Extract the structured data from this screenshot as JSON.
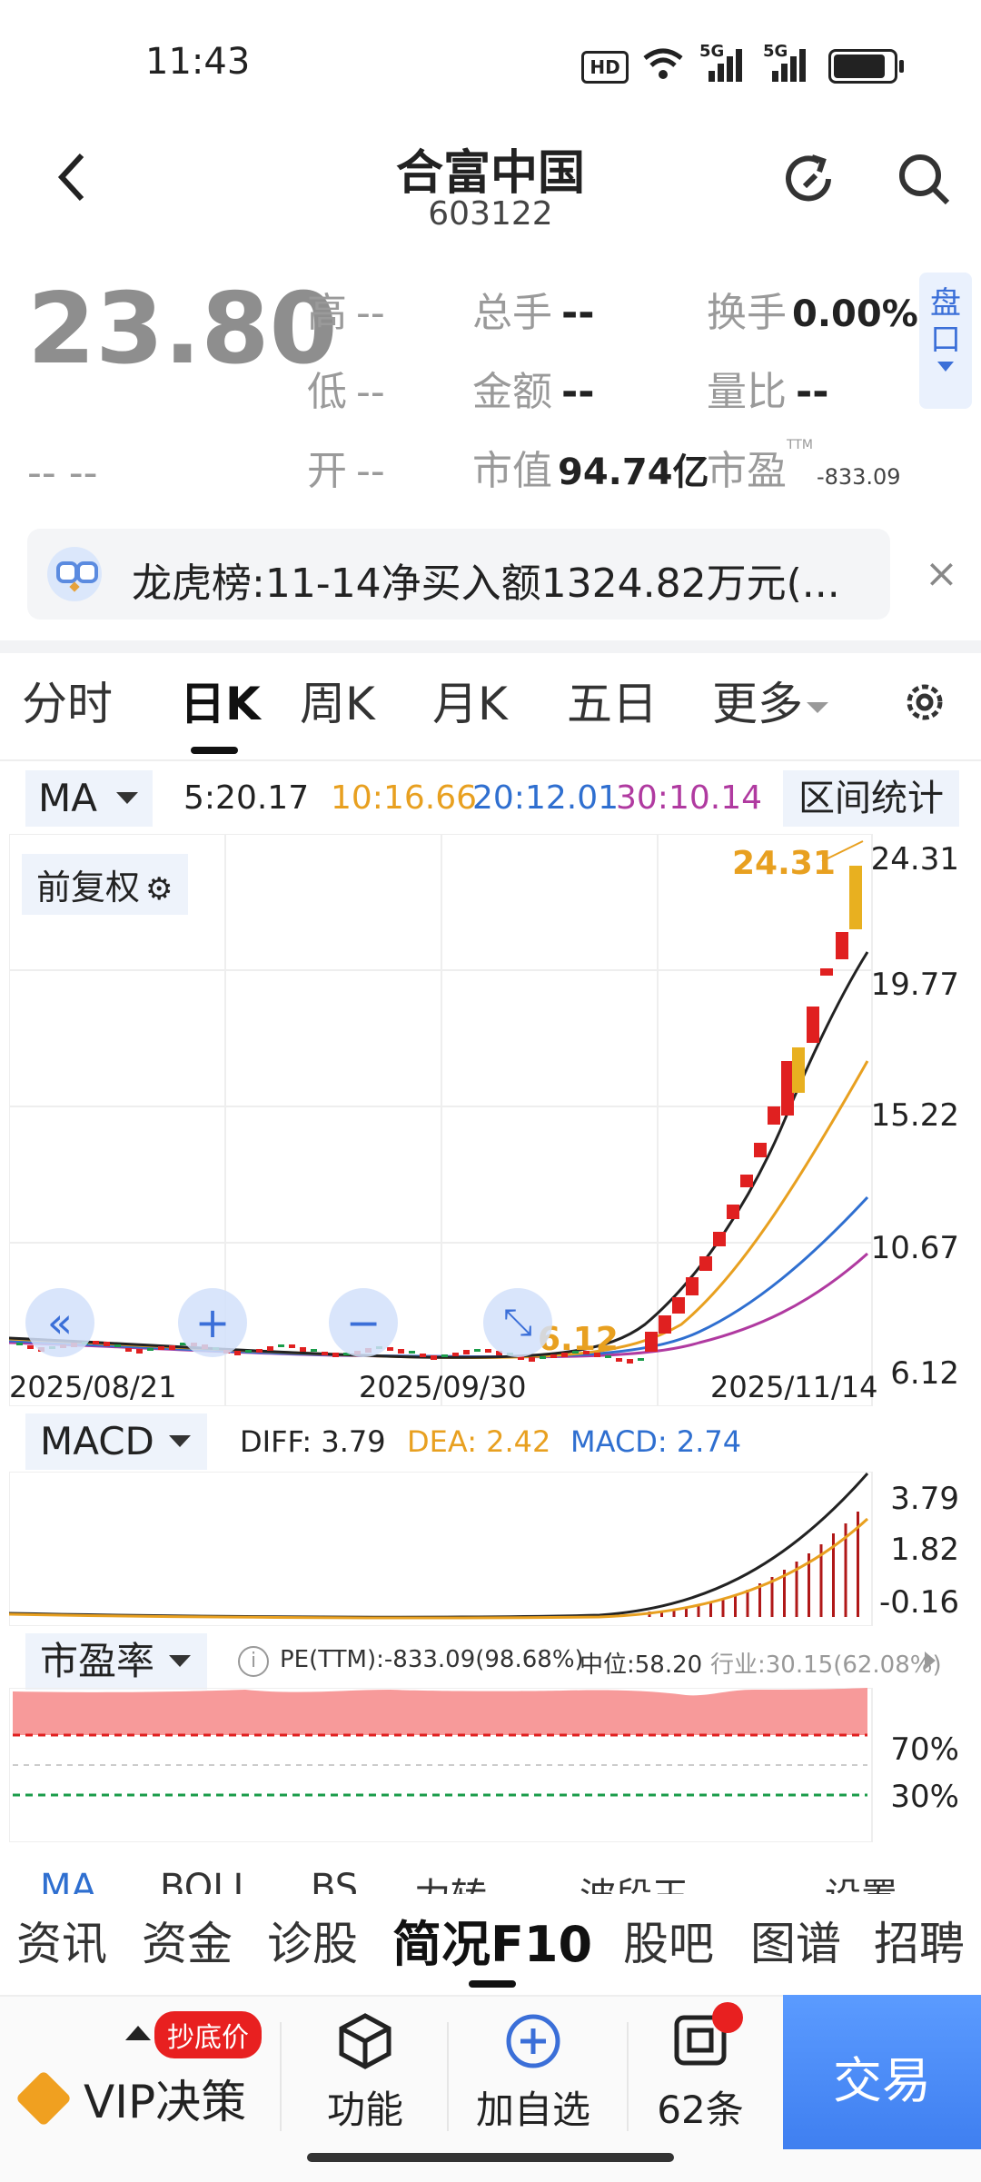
{
  "status_bar": {
    "time": "11:43",
    "hd": "HD",
    "net1": "5G",
    "net2": "5G"
  },
  "header": {
    "title": "合富中国",
    "code": "603122"
  },
  "quote": {
    "price": "23.80",
    "change": "-- --",
    "high_label": "高",
    "high_value": "--",
    "low_label": "低",
    "low_value": "--",
    "open_label": "开",
    "open_value": "--",
    "volume_label": "总手",
    "volume_value": "--",
    "amount_label": "金额",
    "amount_value": "--",
    "mktcap_label": "市值",
    "mktcap_value": "94.74亿",
    "turnover_label": "换手",
    "turnover_value": "0.00%",
    "volratio_label": "量比",
    "volratio_value": "--",
    "pe_label": "市盈",
    "pe_sup": "TTM",
    "pe_value": "-833.09",
    "pankou": "盘口"
  },
  "banner": {
    "text": "龙虎榜:11-14净买入额1324.82万元(..."
  },
  "tabs": [
    "分时",
    "日K",
    "周K",
    "月K",
    "五日",
    "更多"
  ],
  "active_tab": "日K",
  "ma_bar": {
    "selector": "MA",
    "ma5": "5:20.17",
    "ma10": "10:16.66",
    "ma20": "20:12.01",
    "ma30": "30:10.14",
    "range_stats": "区间统计"
  },
  "kline": {
    "adjust_label": "前复权",
    "max_label": "24.31",
    "min_label": "6.12",
    "y_ticks": [
      "24.31",
      "19.77",
      "15.22",
      "10.67",
      "6.12"
    ],
    "x_ticks": [
      "2025/08/21",
      "2025/09/30",
      "2025/11/14"
    ]
  },
  "macd": {
    "selector": "MACD",
    "diff": "DIFF: 3.79",
    "dea": "DEA: 2.42",
    "macd": "MACD: 2.74",
    "y_ticks": [
      "3.79",
      "1.82",
      "-0.16"
    ]
  },
  "pe_panel": {
    "selector": "市盈率",
    "pe_ttm": "PE(TTM):-833.09(98.68%)",
    "median": "中位:58.20",
    "industry": "行业:30.15(62.08%)",
    "y_ticks": [
      "70%",
      "30%"
    ]
  },
  "indicator_row": [
    "MA",
    "BOLL",
    "BS",
    "力转",
    "波段王",
    "设置"
  ],
  "f10_tabs": [
    "资讯",
    "资金",
    "诊股",
    "简况F10",
    "股吧",
    "图谱",
    "招聘"
  ],
  "active_f10": "简况F10",
  "bottom_bar": {
    "vip_badge": "抄底价",
    "vip_label": "VIP决策",
    "func_label": "功能",
    "add_label": "加自选",
    "ask_label": "62条",
    "trade_label": "交易"
  },
  "colors": {
    "up": "#e02020",
    "down": "#1a9c4a",
    "ma5": "#222222",
    "ma10": "#e8a020",
    "ma20": "#2f6fd0",
    "ma30": "#b03aa0",
    "accent": "#3b82f6",
    "trade": "#4a8af4"
  }
}
